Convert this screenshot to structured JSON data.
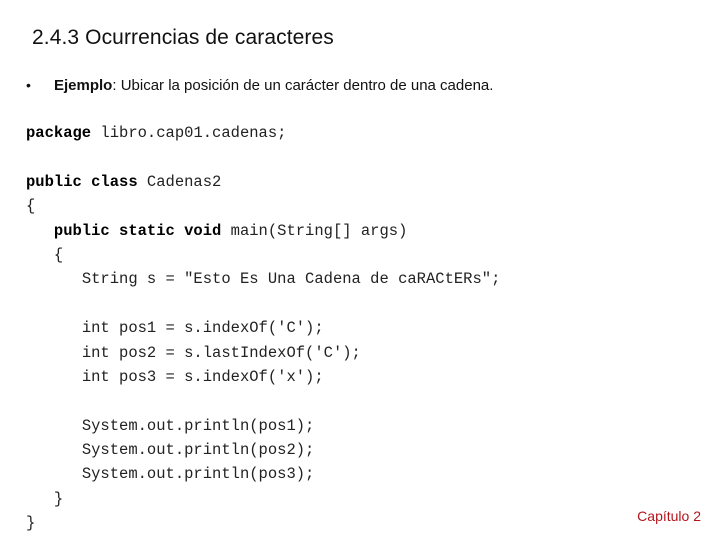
{
  "slide": {
    "title": "2.4.3 Ocurrencias de caracteres",
    "bullet": {
      "label": "Ejemplo",
      "separator": ":",
      "text": " Ubicar la posición de un carácter dentro de una cadena."
    },
    "code_lines": [
      {
        "indent": "",
        "keyword": "package",
        "text": " libro.cap01.cadenas;"
      },
      {
        "indent": "",
        "keyword": "",
        "text": ""
      },
      {
        "indent": "",
        "keyword": "public class",
        "text": " Cadenas2"
      },
      {
        "indent": "",
        "keyword": "",
        "text": "{"
      },
      {
        "indent": "   ",
        "keyword": "public static void",
        "text": " main(String[] args)"
      },
      {
        "indent": "   ",
        "keyword": "",
        "text": "{"
      },
      {
        "indent": "      ",
        "keyword": "",
        "text": "String s = \"Esto Es Una Cadena de caRACtERs\";"
      },
      {
        "indent": "",
        "keyword": "",
        "text": ""
      },
      {
        "indent": "      ",
        "keyword": "",
        "text": "int pos1 = s.indexOf('C');"
      },
      {
        "indent": "      ",
        "keyword": "",
        "text": "int pos2 = s.lastIndexOf('C');"
      },
      {
        "indent": "      ",
        "keyword": "",
        "text": "int pos3 = s.indexOf('x');"
      },
      {
        "indent": "",
        "keyword": "",
        "text": ""
      },
      {
        "indent": "      ",
        "keyword": "",
        "text": "System.out.println(pos1);"
      },
      {
        "indent": "      ",
        "keyword": "",
        "text": "System.out.println(pos2);"
      },
      {
        "indent": "      ",
        "keyword": "",
        "text": "System.out.println(pos3);"
      },
      {
        "indent": "   ",
        "keyword": "",
        "text": "}"
      },
      {
        "indent": "",
        "keyword": "",
        "text": "}"
      }
    ],
    "footer": "Capítulo 2",
    "footer_color": "#b3151b"
  }
}
